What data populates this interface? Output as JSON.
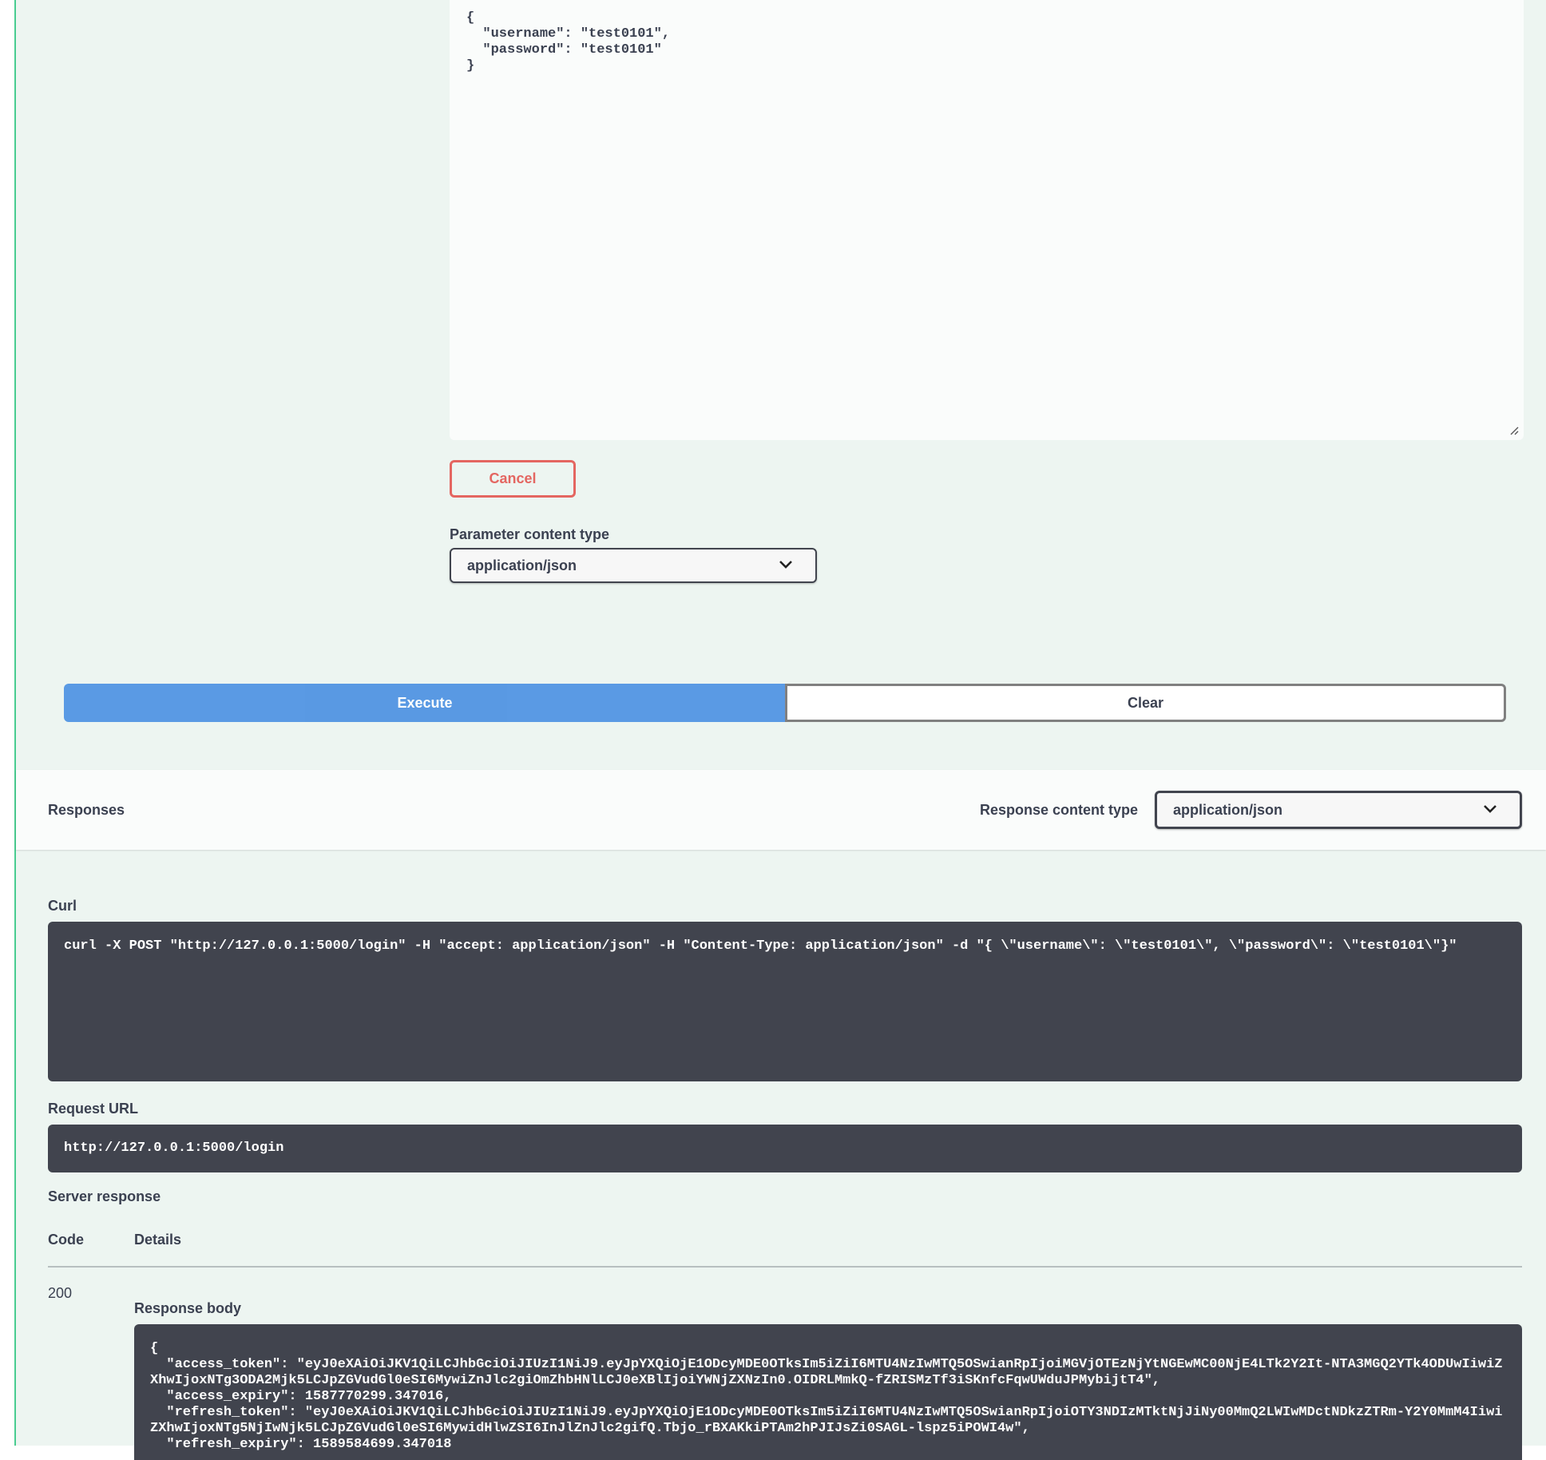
{
  "request_body": {
    "text": "{\n  \"username\": \"test0101\",\n  \"password\": \"test0101\"\n}"
  },
  "cancel_label": "Cancel",
  "param_content_type": {
    "label": "Parameter content type",
    "value": "application/json"
  },
  "execute_label": "Execute",
  "clear_label": "Clear",
  "responses": {
    "title": "Responses",
    "content_type_label": "Response content type",
    "content_type_value": "application/json"
  },
  "curl": {
    "label": "Curl",
    "text": "curl -X POST \"http://127.0.0.1:5000/login\" -H \"accept: application/json\" -H \"Content-Type: application/json\" -d \"{ \\\"username\\\": \\\"test0101\\\", \\\"password\\\": \\\"test0101\\\"}\""
  },
  "request_url": {
    "label": "Request URL",
    "value": "http://127.0.0.1:5000/login"
  },
  "server_response": {
    "label": "Server response",
    "col_code": "Code",
    "col_details": "Details",
    "code": "200",
    "body_label": "Response body",
    "body_text": "{\n  \"access_token\": \"eyJ0eXAiOiJKV1QiLCJhbGciOiJIUzI1NiJ9.eyJpYXQiOjE1ODcyMDE0OTksIm5iZiI6MTU4NzIwMTQ5OSwianRpIjoiMGVjOTEzNjYtNGEwMC00NjE4LTk2Y2It-NTA3MGQ2YTk4ODUwIiwiZXhwIjoxNTg3ODA2Mjk5LCJpZGVudGl0eSI6MywiZnJlc2giOmZhbHNlLCJ0eXBlIjoiYWNjZXNzIn0.OIDRLMmkQ-fZRISMzTf3iSKnfcFqwUWduJPMybijtT4\",\n  \"access_expiry\": 1587770299.347016,\n  \"refresh_token\": \"eyJ0eXAiOiJKV1QiLCJhbGciOiJIUzI1NiJ9.eyJpYXQiOjE1ODcyMDE0OTksIm5iZiI6MTU4NzIwMTQ5OSwianRpIjoiOTY3NDIzMTktNjJiNy00MmQ2LWIwMDctNDkzZTRm-Y2Y0MmM4IiwiZXhwIjoxNTg5NjIwNjk5LCJpZGVudGl0eSI6MywidHlwZSI6InJlZnJlc2gifQ.Tbjo_rBXAKkiPTAm2hPJIJsZi0SAGL-lspz5iPOWI4w\",\n  \"refresh_expiry\": 1589584699.347018"
  }
}
